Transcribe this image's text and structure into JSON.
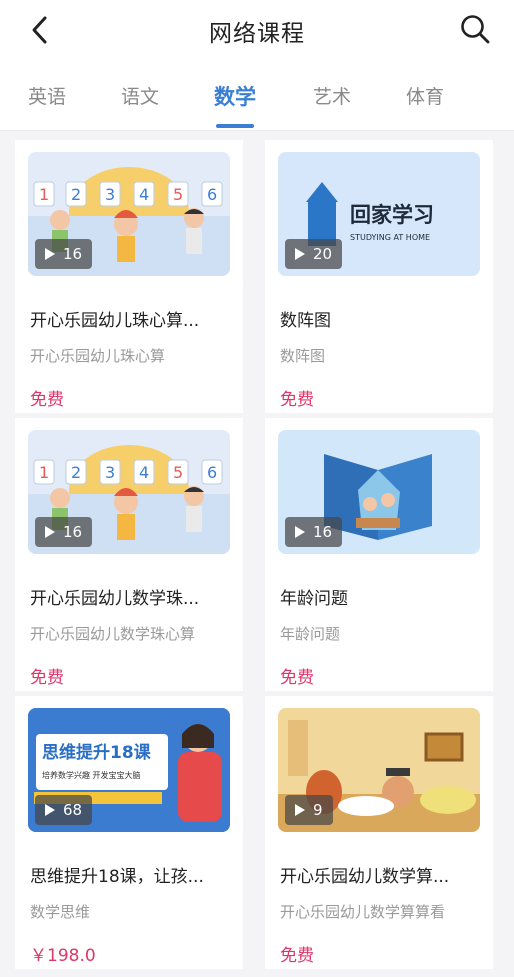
{
  "header": {
    "title": "网络课程",
    "back_icon": "chevron-left-icon",
    "search_icon": "search-icon"
  },
  "tabs": [
    {
      "label": "英语",
      "active": false
    },
    {
      "label": "语文",
      "active": false
    },
    {
      "label": "数学",
      "active": true
    },
    {
      "label": "艺术",
      "active": false
    },
    {
      "label": "体育",
      "active": false
    }
  ],
  "accent_color": "#3a7fd4",
  "price_color": "#e0356a",
  "courses": [
    {
      "title": "开心乐园幼儿珠心算...",
      "subtitle": "开心乐园幼儿珠心算",
      "price": "免费",
      "count": "16",
      "thumb_text": [
        "1",
        "2",
        "3",
        "4",
        "5",
        "6"
      ]
    },
    {
      "title": "数阵图",
      "subtitle": "数阵图",
      "price": "免费",
      "count": "20",
      "thumb_text": [
        "回家学习",
        "STUDYING AT HOME"
      ]
    },
    {
      "title": "开心乐园幼儿数学珠...",
      "subtitle": "开心乐园幼儿数学珠心算",
      "price": "免费",
      "count": "16",
      "thumb_text": [
        "1",
        "2",
        "3",
        "4",
        "5",
        "6"
      ]
    },
    {
      "title": "年龄问题",
      "subtitle": "年龄问题",
      "price": "免费",
      "count": "16"
    },
    {
      "title": "思维提升18课，让孩...",
      "subtitle": "数学思维",
      "price": "￥198.0",
      "count": "68",
      "thumb_text": [
        "思维提升18课",
        "培养数学兴趣 开发宝宝大脑"
      ]
    },
    {
      "title": "开心乐园幼儿数学算...",
      "subtitle": "开心乐园幼儿数学算算看",
      "price": "免费",
      "count": "9"
    }
  ]
}
